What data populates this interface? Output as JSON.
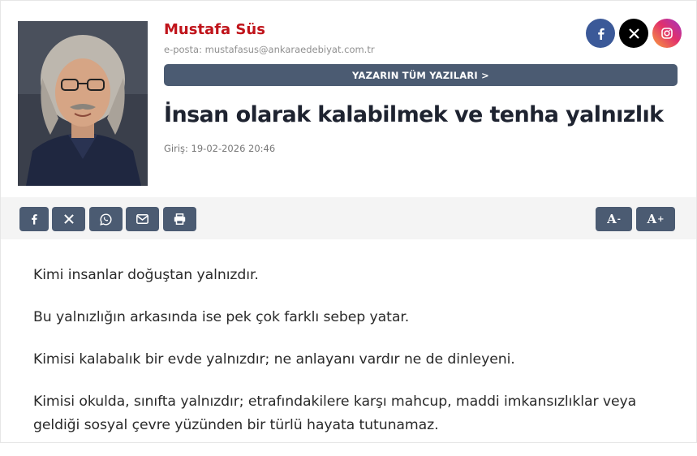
{
  "author": {
    "name": "Mustafa Süs",
    "email": "e-posta: mustafasus@ankaraedebiyat.com.tr",
    "all_posts_label": "YAZARIN TÜM YAZILARI >"
  },
  "social": {
    "facebook_icon": "facebook-icon",
    "x_icon": "x-icon",
    "instagram_icon": "instagram-icon",
    "facebook_color": "#3b5998",
    "x_color": "#000000"
  },
  "article": {
    "title": "İnsan olarak kalabilmek ve tenha yalnızlık",
    "date": "Giriş: 19-02-2026 20:46",
    "paragraphs": [
      "Kimi insanlar doğuştan yalnızdır.",
      "Bu yalnızlığın arkasında ise pek çok farklı sebep yatar.",
      "Kimisi kalabalık bir evde yalnızdır; ne anlayanı vardır ne de dinleyeni.",
      "Kimisi okulda, sınıfta yalnızdır; etrafındakilere karşı mahcup, maddi imkansızlıklar veya geldiği sosyal çevre yüzünden bir türlü hayata tutunamaz."
    ]
  },
  "toolbar": {
    "font_minus_label": "A",
    "font_minus_sign": "-",
    "font_plus_label": "A",
    "font_plus_sign": "+",
    "button_color": "#4b5b72",
    "icons": [
      "facebook-icon",
      "x-icon",
      "whatsapp-icon",
      "mail-icon",
      "print-icon"
    ]
  },
  "colors": {
    "author_name": "#c0141b",
    "title": "#1e2330"
  }
}
